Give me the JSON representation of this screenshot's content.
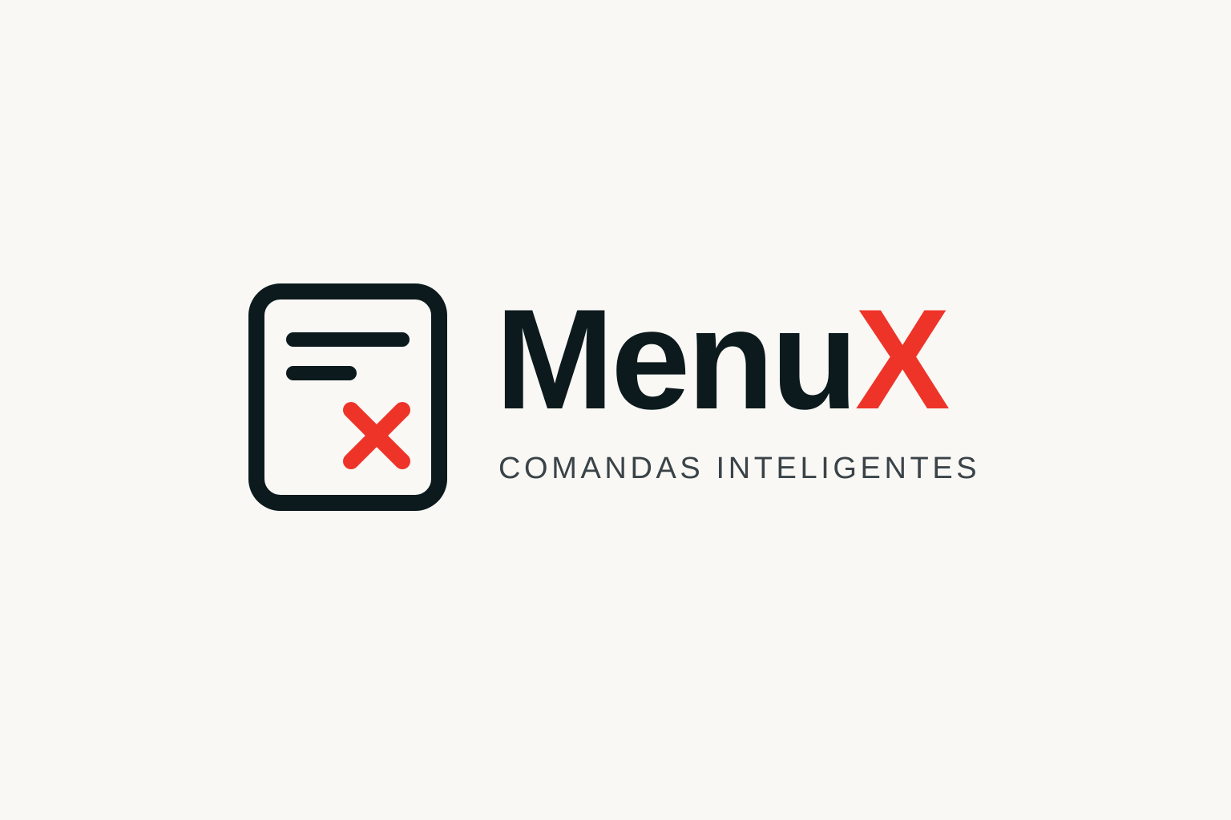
{
  "brand": {
    "name_main": "Menu",
    "name_accent": "X",
    "tagline": "COMANDAS INTELIGENTES"
  },
  "icon": {
    "name": "order-ticket-cancel-icon"
  },
  "colors": {
    "background": "#f9f8f4",
    "primary": "#0c1a1d",
    "accent": "#ee3429",
    "tagline": "#3a4348"
  }
}
